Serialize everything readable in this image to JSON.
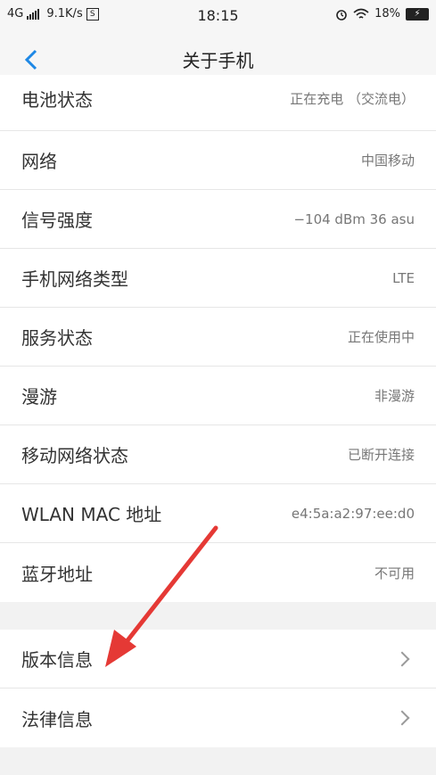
{
  "status_bar": {
    "network_type": "4G",
    "speed": "9.1K/s",
    "sim_icon": "S",
    "time": "18:15",
    "battery": "18%",
    "icons": [
      "signal-icon",
      "sim-icon",
      "alarm-icon",
      "wifi-icon",
      "battery-icon"
    ]
  },
  "header": {
    "title": "关于手机",
    "back_icon": "chevron-left-icon",
    "accent": "#1e88e5"
  },
  "info_rows": [
    {
      "label": "电池状态",
      "value": "正在充电 （交流电）"
    },
    {
      "label": "网络",
      "value": "中国移动"
    },
    {
      "label": "信号强度",
      "value": "−104 dBm   36 asu"
    },
    {
      "label": "手机网络类型",
      "value": "LTE"
    },
    {
      "label": "服务状态",
      "value": "正在使用中"
    },
    {
      "label": "漫游",
      "value": "非漫游"
    },
    {
      "label": "移动网络状态",
      "value": "已断开连接"
    },
    {
      "label": "WLAN MAC 地址",
      "value": "e4:5a:a2:97:ee:d0"
    },
    {
      "label": "蓝牙地址",
      "value": "不可用"
    }
  ],
  "nav_rows": [
    {
      "label": "版本信息"
    },
    {
      "label": "法律信息"
    }
  ],
  "annotation": {
    "arrow_color": "#e53935",
    "icon": "red-arrow-icon"
  }
}
